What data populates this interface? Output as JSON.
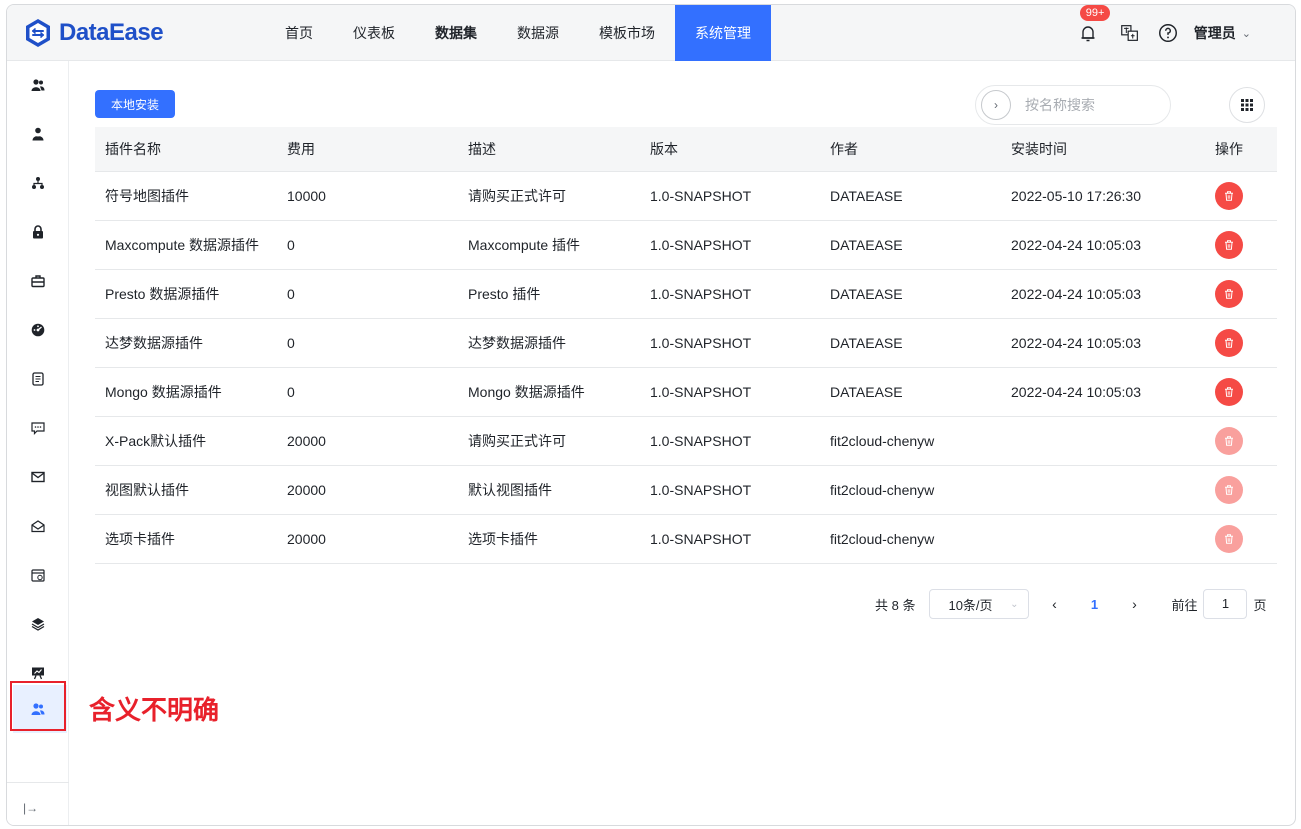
{
  "header": {
    "logo_text": "DataEase",
    "nav": [
      "首页",
      "仪表板",
      "数据集",
      "数据源",
      "模板市场",
      "系统管理"
    ],
    "notification_badge": "99+",
    "user": "管理员"
  },
  "main": {
    "install_button": "本地安装",
    "search_placeholder": "按名称搜索",
    "columns": [
      "插件名称",
      "费用",
      "描述",
      "版本",
      "作者",
      "安装时间",
      "操作"
    ],
    "rows": [
      {
        "name": "符号地图插件",
        "cost": "10000",
        "desc": "请购买正式许可",
        "version": "1.0-SNAPSHOT",
        "author": "DATAEASE",
        "time": "2022-05-10 17:26:30",
        "deletable": true
      },
      {
        "name": "Maxcompute 数据源插件",
        "cost": "0",
        "desc": "Maxcompute 插件",
        "version": "1.0-SNAPSHOT",
        "author": "DATAEASE",
        "time": "2022-04-24 10:05:03",
        "deletable": true
      },
      {
        "name": "Presto 数据源插件",
        "cost": "0",
        "desc": "Presto 插件",
        "version": "1.0-SNAPSHOT",
        "author": "DATAEASE",
        "time": "2022-04-24 10:05:03",
        "deletable": true
      },
      {
        "name": "达梦数据源插件",
        "cost": "0",
        "desc": "达梦数据源插件",
        "version": "1.0-SNAPSHOT",
        "author": "DATAEASE",
        "time": "2022-04-24 10:05:03",
        "deletable": true
      },
      {
        "name": "Mongo 数据源插件",
        "cost": "0",
        "desc": "Mongo 数据源插件",
        "version": "1.0-SNAPSHOT",
        "author": "DATAEASE",
        "time": "2022-04-24 10:05:03",
        "deletable": true
      },
      {
        "name": "X-Pack默认插件",
        "cost": "20000",
        "desc": "请购买正式许可",
        "version": "1.0-SNAPSHOT",
        "author": "fit2cloud-chenyw",
        "time": "",
        "deletable": false
      },
      {
        "name": "视图默认插件",
        "cost": "20000",
        "desc": "默认视图插件",
        "version": "1.0-SNAPSHOT",
        "author": "fit2cloud-chenyw",
        "time": "",
        "deletable": false
      },
      {
        "name": "选项卡插件",
        "cost": "20000",
        "desc": "选项卡插件",
        "version": "1.0-SNAPSHOT",
        "author": "fit2cloud-chenyw",
        "time": "",
        "deletable": false
      }
    ]
  },
  "pagination": {
    "total": "共 8 条",
    "page_size": "10条/页",
    "current_page": "1",
    "goto_prefix": "前往",
    "goto_value": "1",
    "goto_suffix": "页"
  },
  "annotation": "含义不明确",
  "colors": {
    "primary": "#3370ff",
    "danger": "#f54a45",
    "danger_disabled": "#f9a09d",
    "annotation": "#e8212b"
  }
}
